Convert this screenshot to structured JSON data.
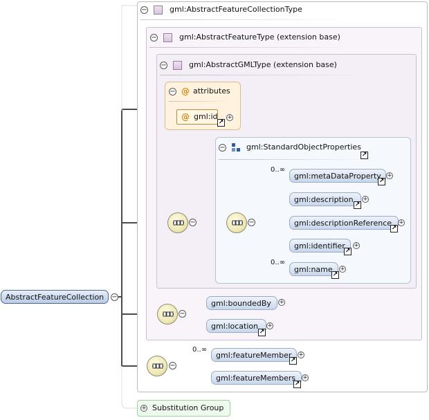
{
  "root": {
    "label": "AbstractFeatureCollection"
  },
  "outer_type": {
    "label": "gml:AbstractFeatureCollectionType"
  },
  "ext_feature_type": {
    "label": "gml:AbstractFeatureType (extension base)"
  },
  "ext_gml_type": {
    "label": "gml:AbstractGMLType (extension base)"
  },
  "attributes": {
    "header": "attributes",
    "items": [
      {
        "label": "gml:id"
      }
    ]
  },
  "standard_props": {
    "label": "gml:StandardObjectProperties",
    "elements": [
      {
        "label": "gml:metaDataProperty",
        "occurs": "0..∞"
      },
      {
        "label": "gml:description",
        "occurs": ""
      },
      {
        "label": "gml:descriptionReference",
        "occurs": ""
      },
      {
        "label": "gml:identifier",
        "occurs": ""
      },
      {
        "label": "gml:name",
        "occurs": "0..∞"
      }
    ]
  },
  "feature_elements": [
    {
      "label": "gml:boundedBy"
    },
    {
      "label": "gml:location"
    }
  ],
  "collection_elements": [
    {
      "label": "gml:featureMember",
      "occurs": "0..∞"
    },
    {
      "label": "gml:featureMembers",
      "occurs": ""
    }
  ],
  "substitution": {
    "label": "Substitution Group"
  },
  "glyphs": {
    "minus": "−",
    "plus": "+",
    "link": "↗",
    "at": "@"
  },
  "icons": {
    "type": "complex-type-icon",
    "group": "model-group-icon",
    "compositor": "sequence-compositor-icon",
    "link": "reference-link-icon"
  },
  "colors": {
    "pill_fill": "#c9d7eb",
    "pill_border": "#98abc6",
    "attr_fill": "#fff3df",
    "connector": "#4a4a4a",
    "substitution_fill": "#eefaee"
  }
}
